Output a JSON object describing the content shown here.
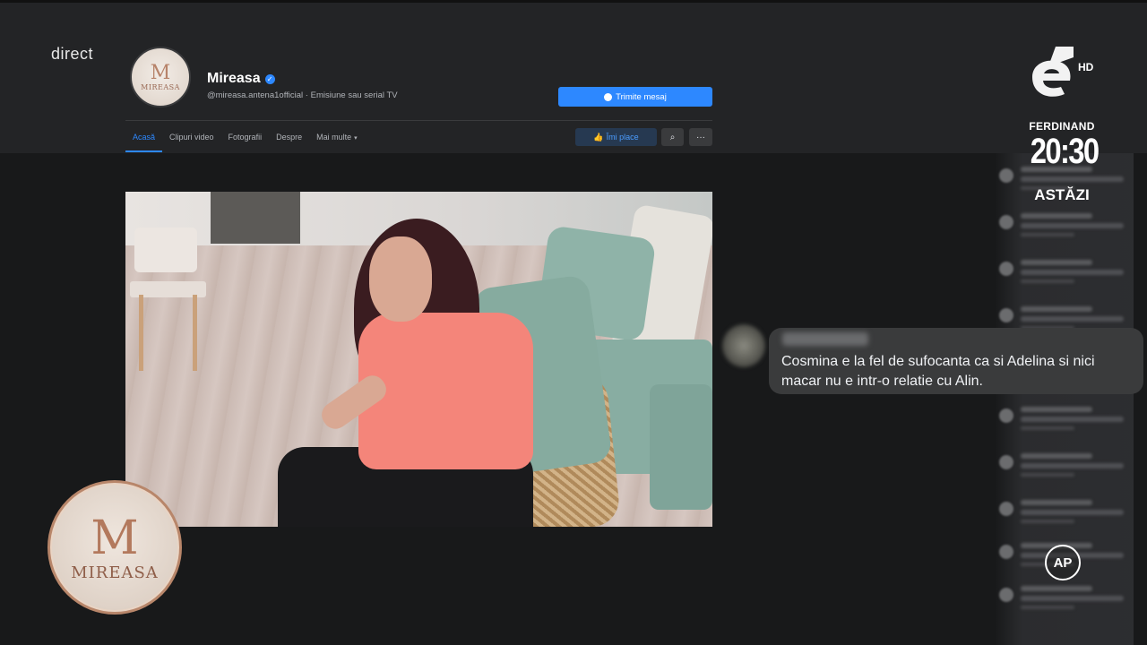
{
  "overlay": {
    "direct_label": "direct",
    "channel_hd": "HD",
    "promo": {
      "name": "FERDINAND",
      "time": "20:30",
      "day": "ASTĂZI"
    },
    "badge": "AP",
    "show_logo": {
      "mono": "M",
      "word": "MIREASA"
    }
  },
  "page": {
    "avatar": {
      "mono": "M",
      "word": "MIREASA"
    },
    "name": "Mireasa",
    "verified_icon": "✓",
    "meta": "@mireasa.antena1official · Emisiune sau serial TV",
    "message_button": "Trimite mesaj",
    "nav": [
      {
        "label": "Acasă",
        "active": true
      },
      {
        "label": "Clipuri video"
      },
      {
        "label": "Fotografii"
      },
      {
        "label": "Despre"
      },
      {
        "label": "Mai multe"
      }
    ],
    "nav_more_caret": "▾",
    "like_button": "Îmi place",
    "like_icon": "👍",
    "search_icon": "⌕",
    "more_icon": "···"
  },
  "comment": {
    "text": "Cosmina e la fel de sufocanta ca si Adelina si nici macar nu e intr-o relatie cu Alin."
  },
  "colors": {
    "accent": "#2d88ff",
    "page_bg": "#18191a",
    "header_bg": "#232426",
    "bubble_bg": "#3a3b3c"
  }
}
